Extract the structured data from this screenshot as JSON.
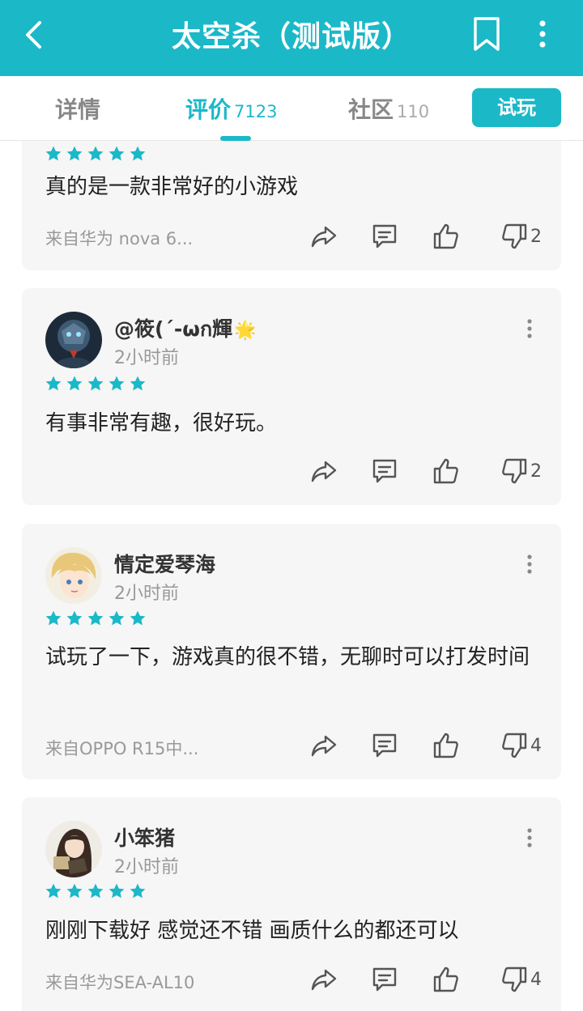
{
  "header": {
    "title": "太空杀（测试版）",
    "accent_color": "#1bb8c8"
  },
  "tabs": [
    {
      "label": "详情",
      "count": ""
    },
    {
      "label": "评价",
      "count": "7123"
    },
    {
      "label": "社区",
      "count": "110"
    }
  ],
  "try_button": "试玩",
  "reviews": [
    {
      "user": "",
      "time": "",
      "stars": 5,
      "text": "真的是一款非常好的小游戏",
      "device": "来自华为 nova 6...",
      "dislikes": "2"
    },
    {
      "user": "@筱(´-ωก輝",
      "user_emoji": "🌟",
      "time": "2小时前",
      "stars": 5,
      "text": "有事非常有趣，很好玩。",
      "device": "",
      "dislikes": "2"
    },
    {
      "user": "情定爱琴海",
      "time": "2小时前",
      "stars": 5,
      "text": "试玩了一下，游戏真的很不错，无聊时可以打发时间",
      "device": "来自OPPO R15中...",
      "dislikes": "4"
    },
    {
      "user": "小笨猪",
      "time": "2小时前",
      "stars": 5,
      "text": "刚刚下载好 感觉还不错 画质什么的都还可以",
      "device": "来自华为SEA-AL10",
      "dislikes": "4"
    }
  ],
  "icons": [
    "back-icon",
    "bookmark-icon",
    "more-vertical-icon",
    "star-icon",
    "share-icon",
    "comment-icon",
    "thumbs-up-icon",
    "thumbs-down-icon"
  ]
}
